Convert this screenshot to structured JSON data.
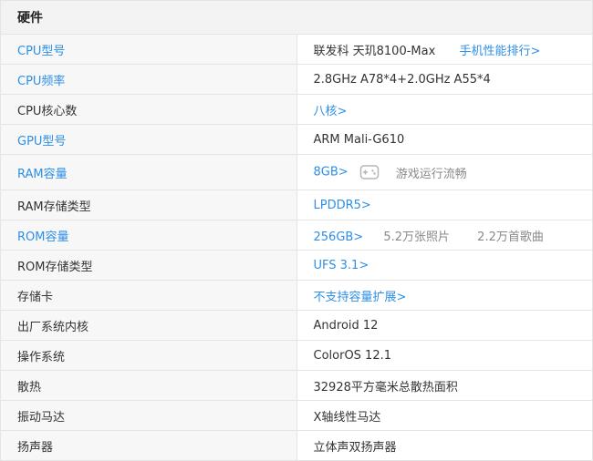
{
  "section": {
    "title": "硬件"
  },
  "rows": {
    "cpu_model": {
      "label": "CPU型号",
      "value": "联发科 天玑8100-Max",
      "link": "手机性能排行>"
    },
    "cpu_freq": {
      "label": "CPU频率",
      "value": "2.8GHz A78*4+2.0GHz A55*4"
    },
    "cpu_cores": {
      "label": "CPU核心数",
      "value": "八核>"
    },
    "gpu_model": {
      "label": "GPU型号",
      "value": "ARM Mali-G610"
    },
    "ram": {
      "label": "RAM容量",
      "value": "8GB>",
      "badge": "游戏运行流畅"
    },
    "ram_type": {
      "label": "RAM存储类型",
      "value": "LPDDR5>"
    },
    "rom": {
      "label": "ROM容量",
      "value": "256GB>",
      "photos": "5.2万张照片",
      "songs": "2.2万首歌曲"
    },
    "rom_type": {
      "label": "ROM存储类型",
      "value": "UFS 3.1>"
    },
    "card": {
      "label": "存储卡",
      "value": "不支持容量扩展>"
    },
    "os_kernel": {
      "label": "出厂系统内核",
      "value": "Android 12"
    },
    "os": {
      "label": "操作系统",
      "value": "ColorOS 12.1"
    },
    "cooling": {
      "label": "散热",
      "value": "32928平方毫米总散热面积"
    },
    "motor": {
      "label": "振动马达",
      "value": "X轴线性马达"
    },
    "speaker": {
      "label": "扬声器",
      "value": "立体声双扬声器"
    }
  },
  "colors": {
    "link": "#2d8fe6",
    "text": "#333333",
    "muted": "#8a8a8a",
    "border": "#e4e4e4",
    "header_bg": "#f3f3f3",
    "label_bg": "#f7f7f7"
  },
  "icons": {
    "ram_badge": "gamepad-icon"
  }
}
